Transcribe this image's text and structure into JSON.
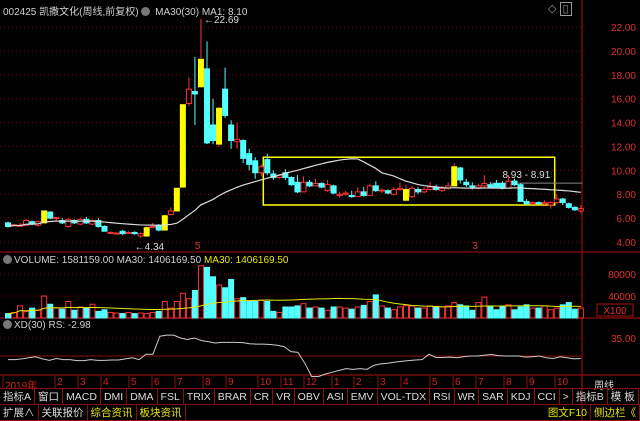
{
  "header": {
    "stock": "002425 凯撒文化(周线,前复权)",
    "indicator": "MA30(30)",
    "ma_value": "MA1: 8.10"
  },
  "price_axis": {
    "ticks": [
      "22.00",
      "20.00",
      "18.00",
      "16.00",
      "14.00",
      "12.00",
      "10.00",
      "8.00",
      "6.00",
      "4.00"
    ],
    "range": [
      4,
      22
    ]
  },
  "annotations": {
    "high_label": "22.69",
    "low_label": "4.34",
    "range_label": "8.93 - 8.91",
    "range_price": 8.93,
    "event_marks": [
      "5",
      "3"
    ],
    "box": {
      "from_candle": 43,
      "to_candle": 90,
      "top": 11.1,
      "bottom": 7.1
    }
  },
  "volume": {
    "title": "VOLUME: 1581159.00",
    "ma_white": "MA30: 1406169.50",
    "ma_yellow": "MA30: 1406169.50",
    "ticks": [
      "80000",
      "40000"
    ],
    "unit": "X100",
    "values": [
      8,
      10,
      22,
      12,
      18,
      14,
      40,
      25,
      18,
      16,
      30,
      14,
      20,
      18,
      25,
      12,
      15,
      10,
      9,
      8,
      10,
      8,
      9,
      8,
      10,
      12,
      30,
      18,
      30,
      45,
      35,
      50,
      95,
      92,
      75,
      60,
      55,
      70,
      35,
      37,
      30,
      30,
      32,
      30,
      12,
      10,
      20,
      20,
      22,
      26,
      18,
      20,
      18,
      14,
      20,
      20,
      18,
      16,
      20,
      23,
      30,
      42,
      22,
      18,
      15,
      20,
      23,
      22,
      18,
      18,
      22,
      20,
      20,
      22,
      28,
      24,
      22,
      14,
      28,
      38,
      22,
      15,
      20,
      24,
      15,
      20,
      24,
      18,
      18,
      22,
      15,
      18,
      24,
      28,
      16,
      18
    ]
  },
  "xd": {
    "title": "XD(30)",
    "rs": "RS: -2.98",
    "ticks": [
      "35.00"
    ],
    "values": [
      29,
      29,
      29.2,
      29.5,
      29.8,
      29.2,
      28.8,
      29.3,
      29,
      29,
      28.7,
      28.7,
      29,
      28.8,
      28.8,
      28.9,
      28.9,
      29.2,
      29.5,
      29,
      30.5,
      30.5,
      35.5,
      35.8,
      35.8,
      35,
      34.6,
      35,
      34.3,
      34,
      33.6,
      33.8,
      33.8,
      33.8,
      33.7,
      33.4,
      33.3,
      33.3,
      33.2,
      33,
      32.6,
      31.2,
      31,
      28,
      24.3,
      24.3,
      25,
      25.5,
      26,
      26.5,
      26.3,
      26.5,
      26.3,
      27.4,
      27.8,
      28,
      28.3,
      28.5,
      28.7,
      28.9,
      29,
      30.5,
      29.6,
      29.6,
      29.7,
      29.5,
      29.8,
      30,
      30,
      30.2,
      30.4,
      30.1,
      30,
      30,
      30,
      29.7,
      29.8,
      30,
      29.5,
      29.3,
      29.8,
      29.5,
      29.2,
      29.3
    ]
  },
  "candles": [
    [
      5.6,
      5.3,
      5.7,
      5.2,
      0
    ],
    [
      5.4,
      5.45,
      5.5,
      5.3,
      0
    ],
    [
      5.4,
      5.4,
      5.6,
      5.3,
      0
    ],
    [
      5.4,
      5.8,
      5.9,
      5.3,
      0
    ],
    [
      5.7,
      5.5,
      5.8,
      5.4,
      0
    ],
    [
      5.4,
      5.7,
      5.8,
      5.3,
      0
    ],
    [
      5.6,
      6.6,
      6.6,
      5.6,
      1
    ],
    [
      6.5,
      6.0,
      6.6,
      5.9,
      0
    ],
    [
      6.0,
      6.05,
      6.1,
      5.8,
      0
    ],
    [
      5.8,
      5.6,
      6.0,
      5.5,
      0
    ],
    [
      5.3,
      5.9,
      6.0,
      5.2,
      0
    ],
    [
      5.8,
      5.6,
      5.9,
      5.5,
      0
    ],
    [
      5.5,
      5.9,
      6.0,
      5.4,
      0
    ],
    [
      5.9,
      5.6,
      6.1,
      5.5,
      0
    ],
    [
      5.5,
      5.8,
      5.9,
      5.4,
      0
    ],
    [
      5.8,
      5.3,
      6.0,
      5.2,
      0
    ],
    [
      5.3,
      4.9,
      5.4,
      4.9,
      0
    ],
    [
      4.75,
      4.8,
      4.9,
      4.7,
      0
    ],
    [
      4.7,
      4.75,
      4.8,
      4.65,
      0
    ],
    [
      4.9,
      4.7,
      5.0,
      4.6,
      0
    ],
    [
      4.75,
      4.8,
      4.9,
      4.7,
      0
    ],
    [
      4.8,
      4.7,
      4.9,
      4.6,
      0
    ],
    [
      4.5,
      4.7,
      4.8,
      4.34,
      0
    ],
    [
      4.5,
      5.2,
      5.3,
      4.5,
      1
    ],
    [
      5.2,
      5.3,
      5.6,
      5.2,
      0
    ],
    [
      5.4,
      5.0,
      5.5,
      4.9,
      0
    ],
    [
      5.0,
      6.2,
      6.3,
      5.0,
      1
    ],
    [
      6.3,
      6.6,
      6.9,
      6.3,
      0
    ],
    [
      6.6,
      8.5,
      8.5,
      6.6,
      1
    ],
    [
      8.6,
      15.5,
      15.5,
      8.6,
      1
    ],
    [
      15.6,
      16.8,
      17.8,
      15.4,
      0
    ],
    [
      16.6,
      16.4,
      19.5,
      13.8,
      0
    ],
    [
      17.0,
      19.3,
      22.69,
      17.0,
      1
    ],
    [
      18.5,
      12.3,
      20.8,
      12.2,
      0
    ],
    [
      13.8,
      12.5,
      16.0,
      12.2,
      0
    ],
    [
      12.2,
      15.2,
      15.3,
      12.0,
      1
    ],
    [
      16.8,
      14.6,
      18.6,
      14.4,
      0
    ],
    [
      13.8,
      12.5,
      14.2,
      11.8,
      0
    ],
    [
      12.4,
      12.6,
      14.0,
      11.8,
      0
    ],
    [
      12.5,
      11.0,
      12.6,
      10.6,
      0
    ],
    [
      11.4,
      10.5,
      11.8,
      10.0,
      0
    ],
    [
      10.8,
      9.8,
      11.1,
      9.3,
      0
    ],
    [
      9.8,
      10.3,
      10.5,
      9.5,
      0
    ],
    [
      10.9,
      9.8,
      11.4,
      9.6,
      0
    ],
    [
      9.7,
      9.4,
      10.0,
      9.2,
      0
    ],
    [
      9.4,
      9.6,
      9.7,
      9.3,
      0
    ],
    [
      9.8,
      9.4,
      10.1,
      9.2,
      0
    ],
    [
      9.4,
      8.8,
      9.5,
      8.7,
      0
    ],
    [
      9.0,
      8.2,
      9.6,
      8.1,
      0
    ],
    [
      8.2,
      9.0,
      9.5,
      8.2,
      0
    ],
    [
      9.0,
      8.7,
      9.2,
      8.6,
      0
    ],
    [
      8.7,
      8.9,
      9.3,
      8.7,
      0
    ],
    [
      8.9,
      8.6,
      9.0,
      8.5,
      0
    ],
    [
      8.3,
      8.8,
      9.2,
      8.2,
      0
    ],
    [
      8.7,
      8.1,
      8.8,
      8.0,
      0
    ],
    [
      7.9,
      8.0,
      8.2,
      7.7,
      0
    ],
    [
      8.0,
      8.1,
      8.3,
      7.9,
      0
    ],
    [
      7.9,
      7.8,
      8.3,
      7.7,
      0
    ],
    [
      7.8,
      8.2,
      8.6,
      7.8,
      0
    ],
    [
      8.2,
      7.9,
      8.6,
      7.8,
      0
    ],
    [
      7.9,
      8.7,
      8.9,
      7.9,
      0
    ],
    [
      8.7,
      8.3,
      9.1,
      8.2,
      0
    ],
    [
      8.3,
      8.35,
      8.5,
      8.1,
      0
    ],
    [
      8.3,
      8.1,
      8.4,
      8.0,
      0
    ],
    [
      8.0,
      8.4,
      8.6,
      7.9,
      0
    ],
    [
      8.4,
      8.5,
      9.0,
      8.3,
      0
    ],
    [
      7.5,
      8.4,
      8.8,
      7.4,
      1
    ],
    [
      7.8,
      8.5,
      8.7,
      7.7,
      0
    ],
    [
      8.4,
      8.2,
      8.6,
      8.0,
      0
    ],
    [
      8.2,
      8.4,
      8.6,
      8.1,
      0
    ],
    [
      8.4,
      8.6,
      9.0,
      8.3,
      0
    ],
    [
      8.6,
      8.4,
      8.8,
      8.3,
      0
    ],
    [
      8.3,
      8.5,
      8.7,
      8.2,
      0
    ],
    [
      8.5,
      8.7,
      9.0,
      8.4,
      0
    ],
    [
      8.7,
      10.3,
      10.6,
      8.7,
      1
    ],
    [
      10.2,
      9.2,
      10.3,
      8.9,
      0
    ],
    [
      9.0,
      8.8,
      9.3,
      8.6,
      0
    ],
    [
      8.7,
      8.6,
      9.0,
      8.4,
      0
    ],
    [
      8.5,
      8.7,
      8.9,
      8.4,
      0
    ],
    [
      8.7,
      8.9,
      9.6,
      8.5,
      0
    ],
    [
      8.8,
      8.6,
      9.0,
      8.5,
      0
    ],
    [
      8.9,
      8.6,
      9.2,
      8.5,
      0
    ],
    [
      8.9,
      8.5,
      9.1,
      8.4,
      0
    ],
    [
      8.5,
      9.1,
      9.6,
      8.5,
      0
    ],
    [
      9.1,
      8.8,
      9.3,
      8.7,
      0
    ],
    [
      8.8,
      7.4,
      8.9,
      7.4,
      0
    ],
    [
      7.4,
      7.2,
      7.6,
      7.1,
      0
    ],
    [
      7.2,
      7.3,
      7.4,
      7.1,
      0
    ],
    [
      7.3,
      7.25,
      7.4,
      7.1,
      0
    ],
    [
      7.2,
      7.3,
      7.5,
      7.1,
      0
    ],
    [
      7.1,
      7.3,
      7.4,
      6.8,
      0
    ],
    [
      7.3,
      7.6,
      8.0,
      7.2,
      0
    ],
    [
      7.6,
      7.3,
      7.7,
      7.1,
      0
    ],
    [
      7.2,
      6.9,
      7.3,
      6.8,
      0
    ],
    [
      6.9,
      6.7,
      7.0,
      6.6,
      0
    ],
    [
      6.6,
      6.8,
      7.1,
      6.4,
      0
    ]
  ],
  "colors": {
    "up": "#ff3232",
    "down": "#54ffff",
    "limit": "#ffff00",
    "grid": "#7a0000",
    "ma": "#dcdcdc",
    "vol_ma": "#e8e800",
    "box": "#ffff00"
  },
  "time_axis": {
    "months": [
      "2019年",
      "2",
      "3",
      "4",
      "5",
      "6",
      "7",
      "8",
      "9",
      "10",
      "11",
      "12",
      "1",
      "2",
      "3",
      "4",
      "5",
      "6",
      "7",
      "8",
      "9",
      "10"
    ],
    "period": "周线"
  },
  "tabs_row1": [
    "指标A",
    "窗口",
    "MACD",
    "DMI",
    "DMA",
    "FSL",
    "TRIX",
    "BRAR",
    "CR",
    "VR",
    "OBV",
    "ASI",
    "EMV",
    "VOL-TDX",
    "RSI",
    "WR",
    "SAR",
    "KDJ",
    "CCI",
    ">"
  ],
  "tabs_row1_right": [
    "指标B",
    "模 板",
    "+",
    "-"
  ],
  "tabs_row2": [
    {
      "label": "扩展∧",
      "hl": false
    },
    {
      "label": "关联报价",
      "hl": false
    },
    {
      "label": "综合资讯",
      "hl": true
    },
    {
      "label": "板块资讯",
      "hl": true
    }
  ],
  "tabs_row2_right": [
    "图文F10",
    "侧边栏《"
  ]
}
